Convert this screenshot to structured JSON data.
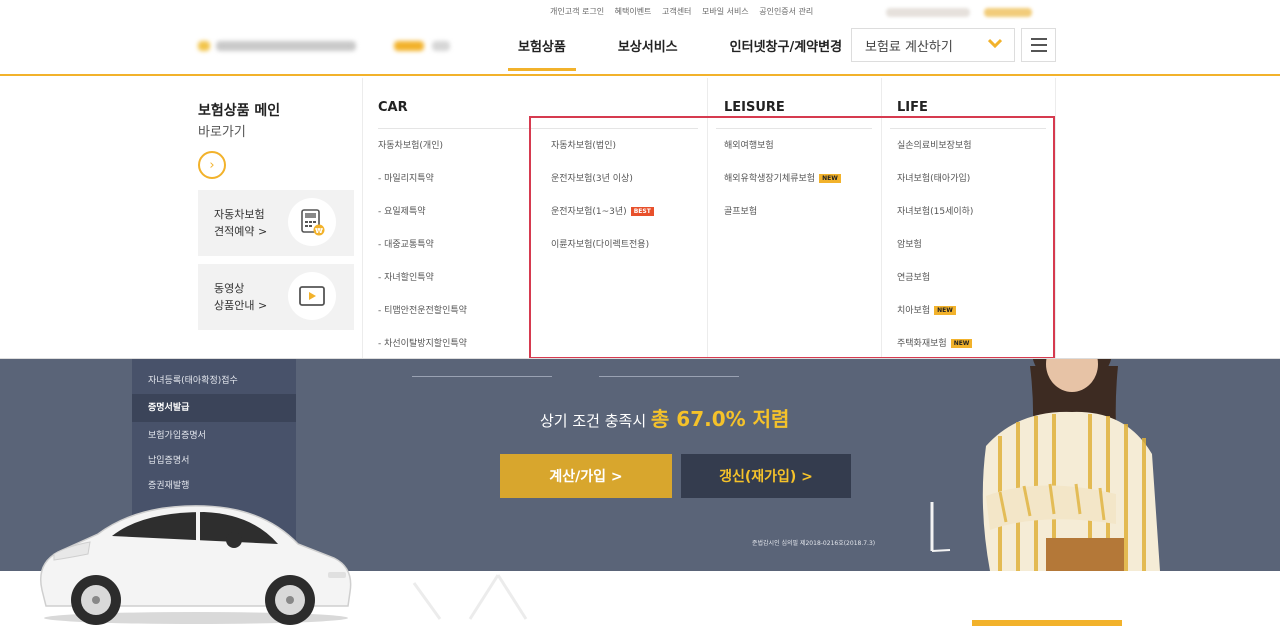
{
  "util": {
    "links": [
      "개인고객 로그인",
      "혜택이벤트",
      "고객센터",
      "모바일 서비스",
      "공인인증서 관리"
    ]
  },
  "nav": {
    "items": [
      "보험상품",
      "보상서비스",
      "인터넷창구/계약변경"
    ],
    "active": "보험상품",
    "calc_label": "보험료 계산하기"
  },
  "mega": {
    "main_title": "보험상품 메인",
    "main_sub": "바로가기",
    "quick1_line1": "자동차보험",
    "quick1_line2": "견적예약 >",
    "quick2_line1": "동영상",
    "quick2_line2": "상품안내 >",
    "car_head": "CAR",
    "leisure_head": "LEISURE",
    "life_head": "LIFE",
    "car_col1": [
      "자동차보험(개인)",
      "- 마일리지특약",
      "- 요일제특약",
      "- 대중교통특약",
      "- 자녀할인특약",
      "- 티맵안전운전할인특약",
      "- 차선이탈방지할인특약"
    ],
    "car_col2": [
      "자동차보험(법인)",
      "운전자보험(3년 이상)",
      "운전자보험(1~3년)",
      "이륜자보험(다이렉트전용)"
    ],
    "car_col2_badge": "BEST",
    "leisure": [
      "해외여행보험",
      "해외유학생장기체류보험",
      "골프보험"
    ],
    "leisure_badge": "NEW",
    "life": [
      "실손의료비보장보험",
      "자녀보험(태아가입)",
      "자녀보험(15세이하)",
      "암보험",
      "연금보험",
      "치아보험",
      "주택화재보험"
    ],
    "life_badge": "NEW"
  },
  "hero": {
    "side_items": [
      "자녀등록(태아확정)접수",
      "증명서발급",
      "보험가입증명서",
      "납입증명서",
      "증권재발행"
    ],
    "side_highlight": "증명서발급",
    "promo_prefix": "상기 조건 충족시",
    "promo_highlight": "총 67.0% 저렴",
    "btn_calc": "계산/가입 >",
    "btn_renew": "갱신(재가입) >",
    "note": "준법감시인 심의필 제2018-0216호(2018.7.3)"
  },
  "colors": {
    "accent": "#f2b22b",
    "hero_bg": "#5a6478",
    "highlight_box": "#d63a4f"
  }
}
